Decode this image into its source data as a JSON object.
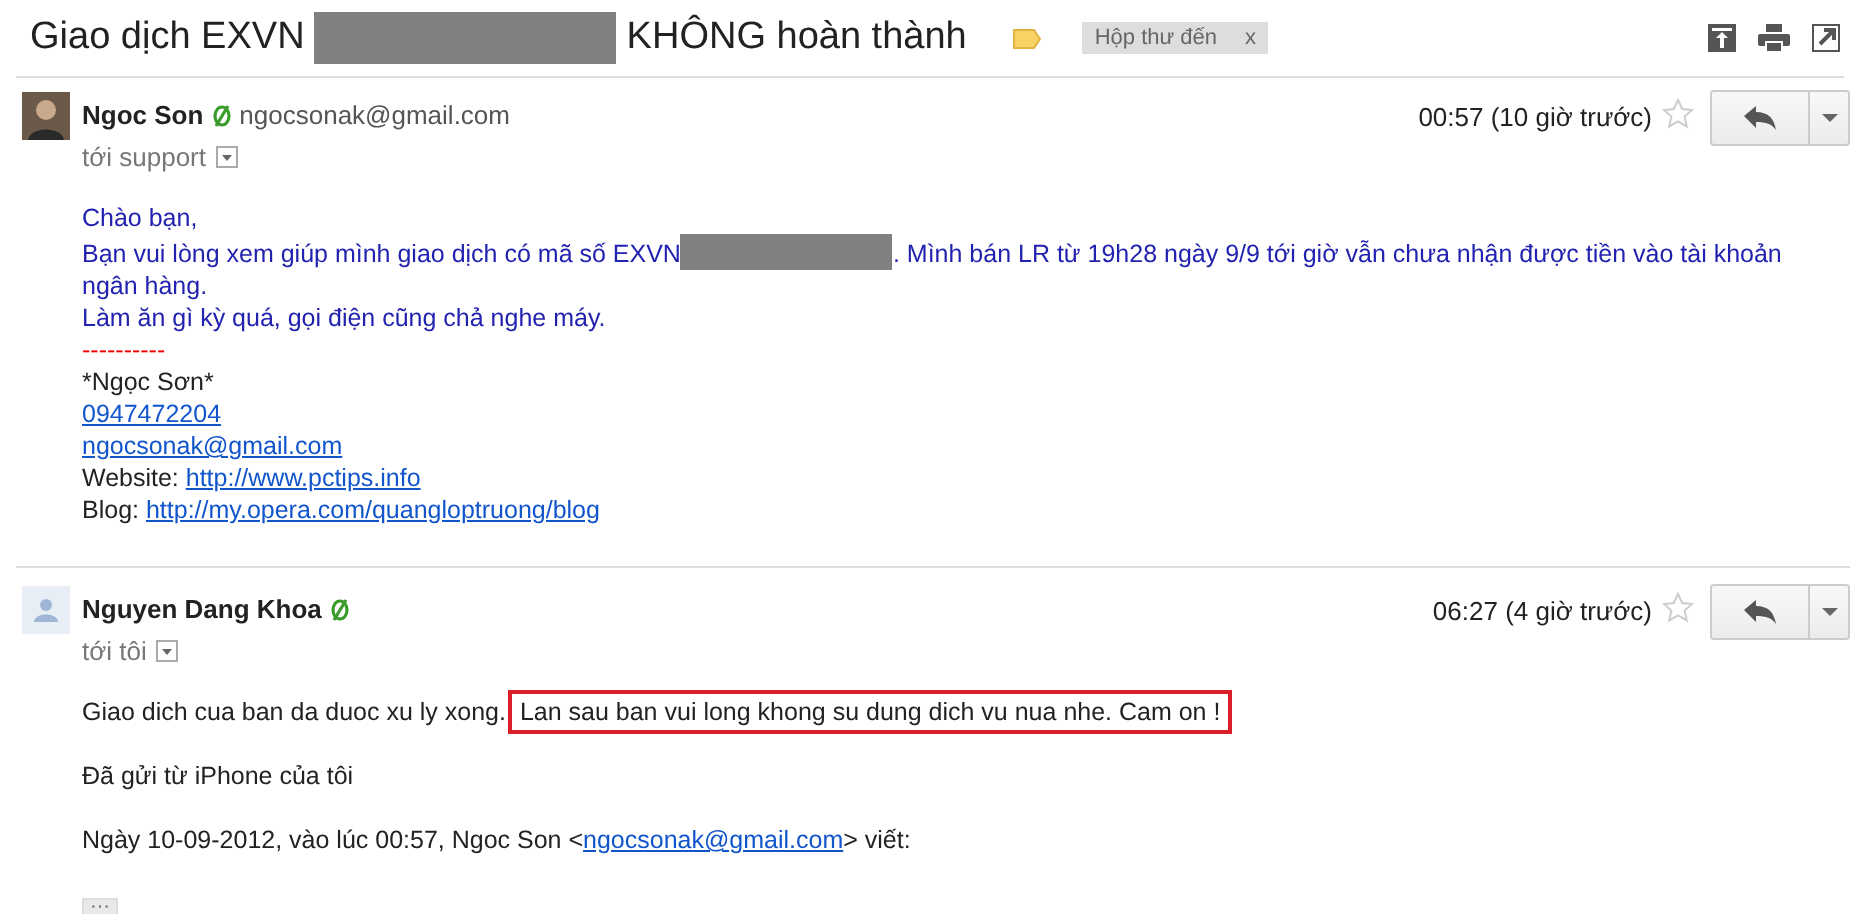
{
  "subject": {
    "title_start": "Giao dịch EXVN",
    "title_end": "KHÔNG hoàn thành",
    "label": "Hộp thư đến",
    "label_remove": "x"
  },
  "messages": [
    {
      "sender": "Ngoc Son",
      "email": "ngocsonak@gmail.com",
      "recipient": "tới support",
      "time": "00:57 (10 giờ trước)",
      "starred": false,
      "avatar": {
        "kind": "photo"
      },
      "paragraphs": [
        {
          "lines": [
            {
              "kind": "blue-text",
              "parts": [
                {
                  "kind": "text",
                  "text": "Chào bạn,"
                }
              ]
            },
            {
              "kind": "blue-text",
              "parts": [
                {
                  "kind": "text",
                  "text": "Bạn vui lòng xem giúp mình giao dịch có mã số EXVN"
                },
                {
                  "kind": "redacted"
                },
                {
                  "kind": "text",
                  "text": ". Mình bán LR từ 19h28 ngày 9/9 tới giờ vẫn chưa nhận được tiền vào tài khoản ngân hàng."
                }
              ]
            },
            {
              "kind": "blue-text",
              "parts": [
                {
                  "kind": "text",
                  "text": "Làm ăn gì kỳ quá, gọi điện cũng chả nghe máy."
                }
              ]
            },
            {
              "kind": "divider",
              "parts": [
                {
                  "kind": "text",
                  "text": "----------"
                }
              ]
            },
            {
              "kind": "plain-text",
              "parts": [
                {
                  "kind": "text",
                  "text": "*Ngọc Sơn*"
                }
              ]
            },
            {
              "kind": "plain-text",
              "parts": [
                {
                  "kind": "link",
                  "text": "0947472204"
                }
              ]
            },
            {
              "kind": "plain-text",
              "parts": [
                {
                  "kind": "link",
                  "text": "ngocsonak@gmail.com"
                }
              ]
            },
            {
              "kind": "plain-text",
              "parts": [
                {
                  "kind": "text",
                  "text": "Website: "
                },
                {
                  "kind": "link",
                  "text": "http://www.pctips.info"
                }
              ]
            },
            {
              "kind": "plain-text",
              "parts": [
                {
                  "kind": "text",
                  "text": "Blog: "
                },
                {
                  "kind": "link",
                  "text": "http://my.opera.com/quangloptruong/blog"
                }
              ]
            }
          ]
        }
      ]
    },
    {
      "sender": "Nguyen Dang Khoa",
      "recipient": "tới tôi",
      "time": "06:27 (4 giờ trước)",
      "starred": false,
      "avatar": {
        "kind": "default"
      },
      "paragraphs": [
        {
          "lines": [
            {
              "kind": "plain-text",
              "parts": [
                {
                  "kind": "text",
                  "text": "Giao dich cua ban da duoc xu ly xong."
                },
                {
                  "kind": "boxed",
                  "text": "Lan sau ban vui long khong su dung dich vu nua nhe. Cam on !"
                }
              ]
            }
          ]
        },
        {
          "lines": [
            {
              "kind": "plain-text",
              "parts": [
                {
                  "kind": "text",
                  "text": "Đã gửi từ iPhone của tôi"
                }
              ]
            }
          ]
        },
        {
          "lines": [
            {
              "kind": "plain-text",
              "parts": [
                {
                  "kind": "text",
                  "text": "Ngày 10-09-2012, vào lúc 00:57, Ngoc Son <"
                },
                {
                  "kind": "link",
                  "text": "ngocsonak@gmail.com"
                },
                {
                  "kind": "text",
                  "text": "> viết:"
                }
              ]
            }
          ]
        },
        {
          "lines": [
            {
              "kind": "ellipsis",
              "text": "···"
            }
          ]
        }
      ]
    }
  ]
}
